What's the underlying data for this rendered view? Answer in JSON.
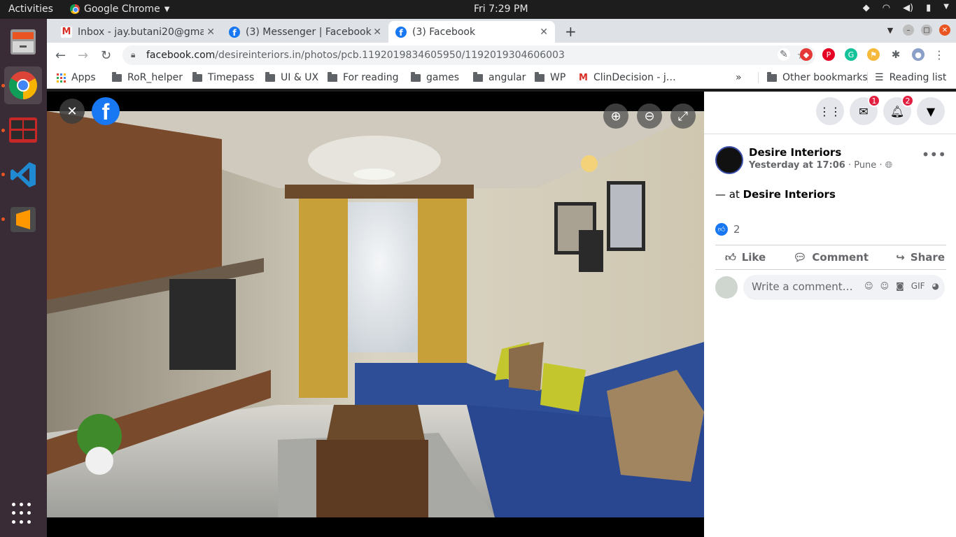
{
  "system": {
    "activities": "Activities",
    "app_name": "Google Chrome",
    "clock": "Fri  7:29 PM"
  },
  "tabs": [
    {
      "title": "Inbox - jay.butani20@gma",
      "icon": "gmail-icon"
    },
    {
      "title": "(3) Messenger | Facebook",
      "icon": "facebook-icon"
    },
    {
      "title": "(3) Facebook",
      "icon": "facebook-icon",
      "active": true
    }
  ],
  "address": {
    "domain": "facebook.com",
    "path": "/desireinteriors.in/photos/pcb.1192019834605950/1192019304606003"
  },
  "bookmarks": {
    "items": [
      "Apps",
      "RoR_helper",
      "Timepass",
      "UI & UX",
      "For reading",
      "games",
      "angular",
      "WP",
      "ClinDecision - j…"
    ],
    "overflow": "»",
    "other": "Other bookmarks",
    "reading_list": "Reading list"
  },
  "header": {
    "messenger_badge": "1",
    "notifications_badge": "2"
  },
  "post": {
    "author": "Desire Interiors",
    "time": "Yesterday at 17:06",
    "location": "Pune",
    "at_prefix": "— at",
    "at_place": "Desire Interiors",
    "reaction_count": "2",
    "like_label": "Like",
    "comment_label": "Comment",
    "share_label": "Share",
    "comment_placeholder": "Write a comment…"
  },
  "colors": {
    "facebook_blue": "#1877f2",
    "badge_red": "#e41e3f",
    "ubuntu_orange": "#e95420"
  }
}
